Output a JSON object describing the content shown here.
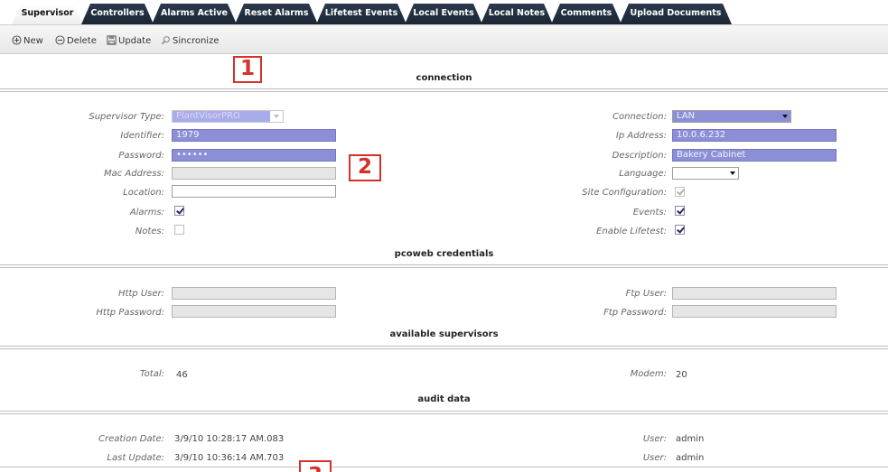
{
  "tabs": [
    {
      "label": "Supervisor",
      "active": true
    },
    {
      "label": "Controllers"
    },
    {
      "label": "Alarms Active"
    },
    {
      "label": "Reset Alarms"
    },
    {
      "label": "Lifetest Events"
    },
    {
      "label": "Local Events"
    },
    {
      "label": "Local Notes"
    },
    {
      "label": "Comments"
    },
    {
      "label": "Upload Documents"
    }
  ],
  "toolbar": {
    "new_label": "New",
    "delete_label": "Delete",
    "update_label": "Update",
    "sync_label": "Sincronize"
  },
  "markers": {
    "m1": "1",
    "m2": "2",
    "m3": "3"
  },
  "sections": {
    "connection": "connection",
    "pcoweb": "pcoweb credentials",
    "available": "available supervisors",
    "audit": "audit data"
  },
  "connection": {
    "supervisor_type_label": "Supervisor Type:",
    "supervisor_type_value": "PlantVisorPRO",
    "identifier_label": "Identifier:",
    "identifier_value": "1979",
    "password_label": "Password:",
    "password_value": "••••••",
    "mac_label": "Mac Address:",
    "mac_value": "",
    "location_label": "Location:",
    "location_value": "",
    "alarms_label": "Alarms:",
    "alarms_checked": true,
    "notes_label": "Notes:",
    "notes_checked": false,
    "connection_label": "Connection:",
    "connection_value": "LAN",
    "ip_label": "Ip Address:",
    "ip_value": "10.0.6.232",
    "description_label": "Description:",
    "description_value": "Bakery Cabinet",
    "language_label": "Language:",
    "language_value": "",
    "site_config_label": "Site Configuration:",
    "site_config_checked": true,
    "events_label": "Events:",
    "events_checked": true,
    "lifetest_label": "Enable Lifetest:",
    "lifetest_checked": true
  },
  "pcoweb": {
    "http_user_label": "Http User:",
    "http_password_label": "Http Password:",
    "ftp_user_label": "Ftp User:",
    "ftp_password_label": "Ftp Password:"
  },
  "available": {
    "total_label": "Total:",
    "total_value": "46",
    "modem_label": "Modem:",
    "modem_value": "20"
  },
  "audit": {
    "creation_label": "Creation Date:",
    "creation_value": "3/9/10 10:28:17 AM.083",
    "last_update_label": "Last Update:",
    "last_update_value": "3/9/10 10:36:14 AM.703",
    "user1_label": "User:",
    "user1_value": "admin",
    "user2_label": "User:",
    "user2_value": "admin"
  },
  "colors": {
    "tab_dark": "#1f2a3a",
    "field_highlight": "#8c8fd6",
    "marker_red": "#d4312b"
  }
}
